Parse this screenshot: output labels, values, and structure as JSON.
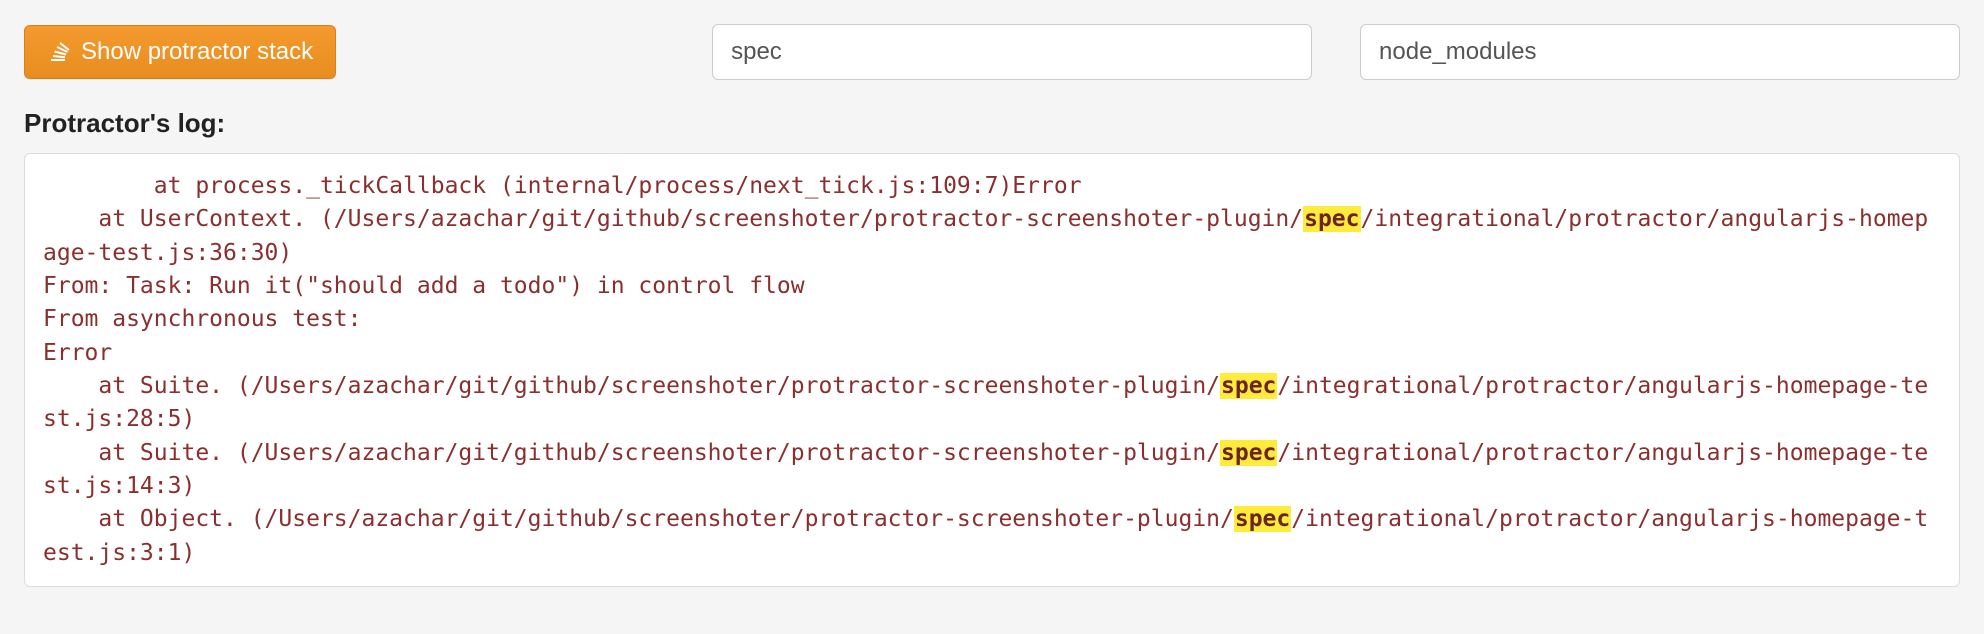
{
  "toolbar": {
    "show_stack_label": "Show protractor stack",
    "filter1_value": "spec",
    "filter2_value": "node_modules"
  },
  "log": {
    "title": "Protractor's log:",
    "highlight_term": "spec",
    "lines": [
      {
        "indent": 2,
        "parts": [
          {
            "t": "at process._tickCallback (internal/process/next_tick.js:109:7)Error"
          }
        ]
      },
      {
        "indent": 1,
        "parts": [
          {
            "t": "at UserContext. (/Users/azachar/git/github/screenshoter/protractor-screenshoter-plugin/"
          },
          {
            "t": "spec",
            "hl": true
          },
          {
            "t": "/integrational/protractor/angularjs-homepage-test.js:36:30)"
          }
        ]
      },
      {
        "indent": 0,
        "parts": [
          {
            "t": "From: Task: Run it(\"should add a todo\") in control flow"
          }
        ]
      },
      {
        "indent": 0,
        "parts": [
          {
            "t": "From asynchronous test:"
          }
        ]
      },
      {
        "indent": 0,
        "parts": [
          {
            "t": "Error"
          }
        ]
      },
      {
        "indent": 1,
        "parts": [
          {
            "t": "at Suite. (/Users/azachar/git/github/screenshoter/protractor-screenshoter-plugin/"
          },
          {
            "t": "spec",
            "hl": true
          },
          {
            "t": "/integrational/protractor/angularjs-homepage-test.js:28:5)"
          }
        ]
      },
      {
        "indent": 1,
        "parts": [
          {
            "t": "at Suite. (/Users/azachar/git/github/screenshoter/protractor-screenshoter-plugin/"
          },
          {
            "t": "spec",
            "hl": true
          },
          {
            "t": "/integrational/protractor/angularjs-homepage-test.js:14:3)"
          }
        ]
      },
      {
        "indent": 1,
        "parts": [
          {
            "t": "at Object. (/Users/azachar/git/github/screenshoter/protractor-screenshoter-plugin/"
          },
          {
            "t": "spec",
            "hl": true
          },
          {
            "t": "/integrational/protractor/angularjs-homepage-test.js:3:1)"
          }
        ]
      }
    ]
  }
}
